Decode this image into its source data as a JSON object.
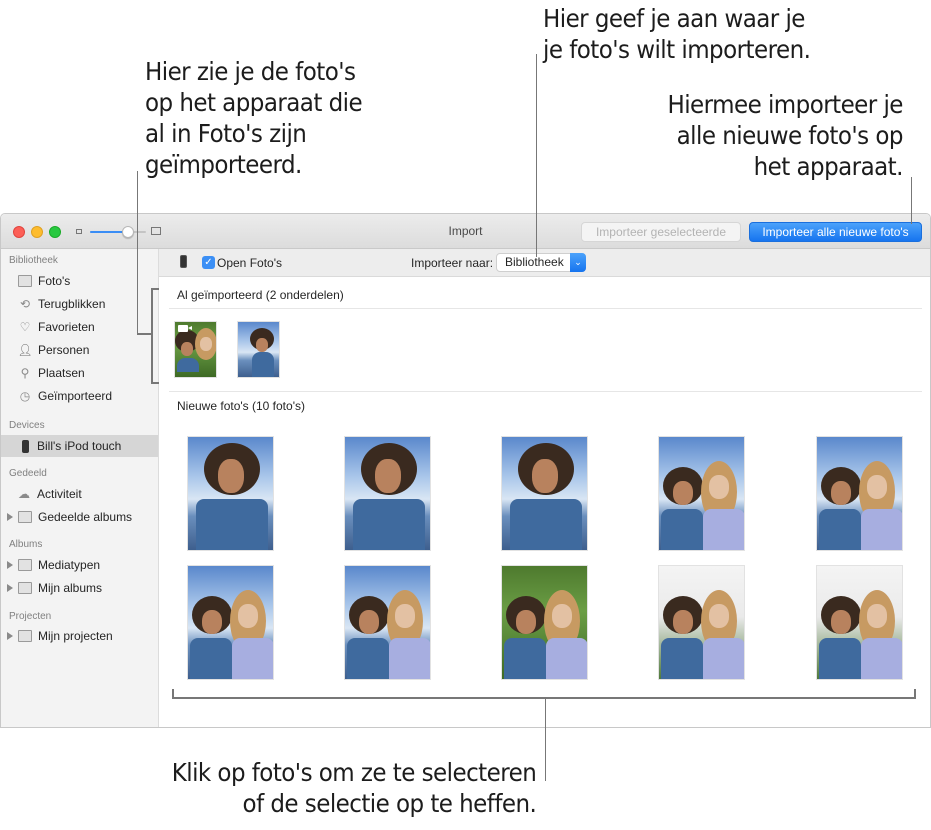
{
  "callouts": {
    "already_imported": [
      "Hier zie je de foto's",
      "op het apparaat die",
      "al in Foto's zijn",
      "geïmporteerd."
    ],
    "import_destination": [
      "Hier geef je aan waar je",
      "je foto's wilt importeren."
    ],
    "import_all": [
      "Hiermee importeer je",
      "alle nieuwe foto's op",
      "het apparaat."
    ],
    "select_photos": [
      "Klik op foto's om ze te selecteren",
      "of de selectie op te heffen."
    ]
  },
  "window": {
    "title": "Import",
    "zoom_slider_level": 0.68,
    "buttons": {
      "import_selected": "Importeer geselecteerde",
      "import_all_new": "Importeer alle nieuwe foto's"
    }
  },
  "toolbar": {
    "open_photos_label": "Open Foto's",
    "open_photos_checked": true,
    "import_to_label": "Importeer naar:",
    "import_to_value": "Bibliotheek"
  },
  "sidebar": {
    "sections": [
      {
        "title": "Bibliotheek",
        "items": [
          {
            "label": "Foto's",
            "icon": "photos-icon"
          },
          {
            "label": "Terugblikken",
            "icon": "memories-icon"
          },
          {
            "label": "Favorieten",
            "icon": "heart-icon"
          },
          {
            "label": "Personen",
            "icon": "person-icon"
          },
          {
            "label": "Plaatsen",
            "icon": "pin-icon"
          },
          {
            "label": "Geïmporteerd",
            "icon": "clock-icon"
          }
        ]
      },
      {
        "title": "Devices",
        "items": [
          {
            "label": "Bill's iPod touch",
            "icon": "device-icon",
            "selected": true
          }
        ]
      },
      {
        "title": "Gedeeld",
        "items": [
          {
            "label": "Activiteit",
            "icon": "cloud-icon"
          },
          {
            "label": "Gedeelde albums",
            "icon": "folder-icon",
            "disclosure": true
          }
        ]
      },
      {
        "title": "Albums",
        "items": [
          {
            "label": "Mediatypen",
            "icon": "folder-icon",
            "disclosure": true
          },
          {
            "label": "Mijn albums",
            "icon": "folder-icon",
            "disclosure": true
          }
        ]
      },
      {
        "title": "Projecten",
        "items": [
          {
            "label": "Mijn projecten",
            "icon": "folder-icon",
            "disclosure": true
          }
        ]
      }
    ]
  },
  "main": {
    "already_imported_title": "Al geïmporteerd (2 onderdelen)",
    "already_imported_count": 2,
    "new_photos_title": "Nieuwe foto's (10 foto's)",
    "new_photos_count": 10
  }
}
